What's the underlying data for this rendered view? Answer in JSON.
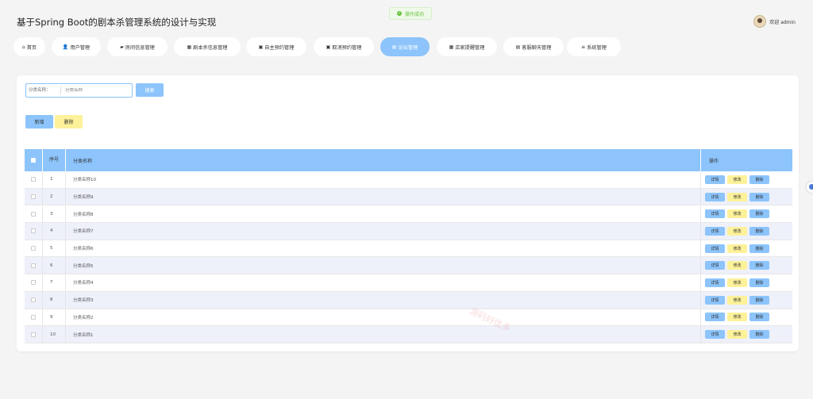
{
  "app": {
    "title": "基于Spring Boot的剧本杀管理系统的设计与实现"
  },
  "toast": {
    "text": "操作成功"
  },
  "user": {
    "welcome": "欢迎 admin"
  },
  "nav": {
    "items": [
      {
        "label": "首页",
        "icon": "home-icon",
        "glyph": "⌂"
      },
      {
        "label": "用户管理",
        "icon": "user-icon",
        "glyph": "👤"
      },
      {
        "label": "房间信息管理",
        "icon": "folder-icon",
        "glyph": "▰"
      },
      {
        "label": "剧本杀信息管理",
        "icon": "grid-icon",
        "glyph": "▦"
      },
      {
        "label": "自主预约管理",
        "icon": "calendar-icon",
        "glyph": "▣"
      },
      {
        "label": "取消预约管理",
        "icon": "calendar-icon",
        "glyph": "▣"
      },
      {
        "label": "论坛管理",
        "icon": "forum-icon",
        "glyph": "▤"
      },
      {
        "label": "店家提醒管理",
        "icon": "table-icon",
        "glyph": "▦"
      },
      {
        "label": "客服聊天管理",
        "icon": "chat-icon",
        "glyph": "▤"
      },
      {
        "label": "系统管理",
        "icon": "list-icon",
        "glyph": "≡"
      }
    ]
  },
  "search": {
    "label": "分类名称：",
    "placeholder": "分类名称",
    "button": "搜索"
  },
  "actions": {
    "add": "新增",
    "delete": "删除"
  },
  "table": {
    "headers": {
      "no": "序号",
      "name": "分类名称",
      "ops": "操作"
    },
    "op_labels": {
      "detail": "详情",
      "edit": "修改",
      "delete": "删除"
    },
    "rows": [
      {
        "no": "1",
        "name": "分类名称10"
      },
      {
        "no": "2",
        "name": "分类名称9"
      },
      {
        "no": "3",
        "name": "分类名称8"
      },
      {
        "no": "4",
        "name": "分类名称7"
      },
      {
        "no": "5",
        "name": "分类名称6"
      },
      {
        "no": "6",
        "name": "分类名称5"
      },
      {
        "no": "7",
        "name": "分类名称4"
      },
      {
        "no": "8",
        "name": "分类名称3"
      },
      {
        "no": "9",
        "name": "分类名称2"
      },
      {
        "no": "10",
        "name": "分类名称1"
      }
    ]
  },
  "watermark": "源码好优多",
  "colors": {
    "primary": "#8cc4fb",
    "warning": "#fdf29a",
    "row_alt": "#eef0fa",
    "success": "#67c23a"
  }
}
